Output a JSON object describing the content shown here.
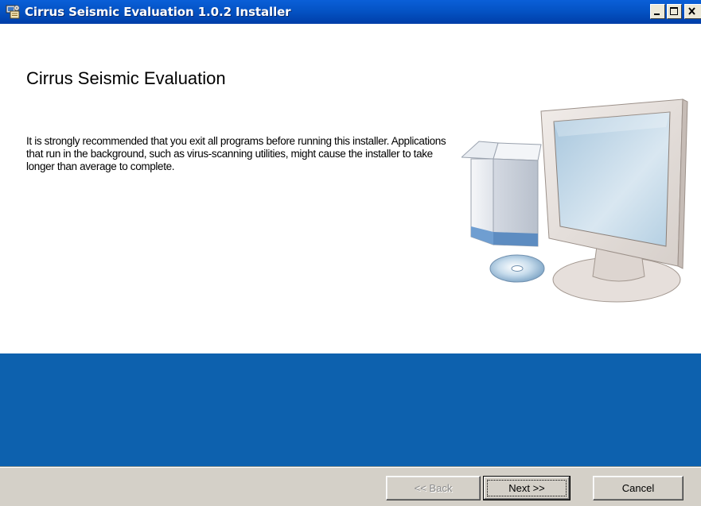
{
  "window": {
    "title": "Cirrus Seismic Evaluation 1.0.2 Installer",
    "controls": [
      "minimize-icon",
      "maximize-icon",
      "close-icon"
    ]
  },
  "content": {
    "heading": "Cirrus Seismic Evaluation",
    "intro": "It is strongly recommended that you exit all programs before running this installer. Applications that run in the background, such as virus-scanning utilities, might cause the installer to take longer than average to complete."
  },
  "illustration": {
    "icon": "computer-with-box-and-cd-icon"
  },
  "buttons": {
    "back": {
      "label": "<< Back",
      "enabled": false
    },
    "next": {
      "label": "Next >>",
      "enabled": true,
      "default": true
    },
    "cancel": {
      "label": "Cancel",
      "enabled": true
    }
  },
  "colors": {
    "titlebar": "#0453c5",
    "band": "#0d61ae",
    "panel": "#d4d0c8"
  }
}
